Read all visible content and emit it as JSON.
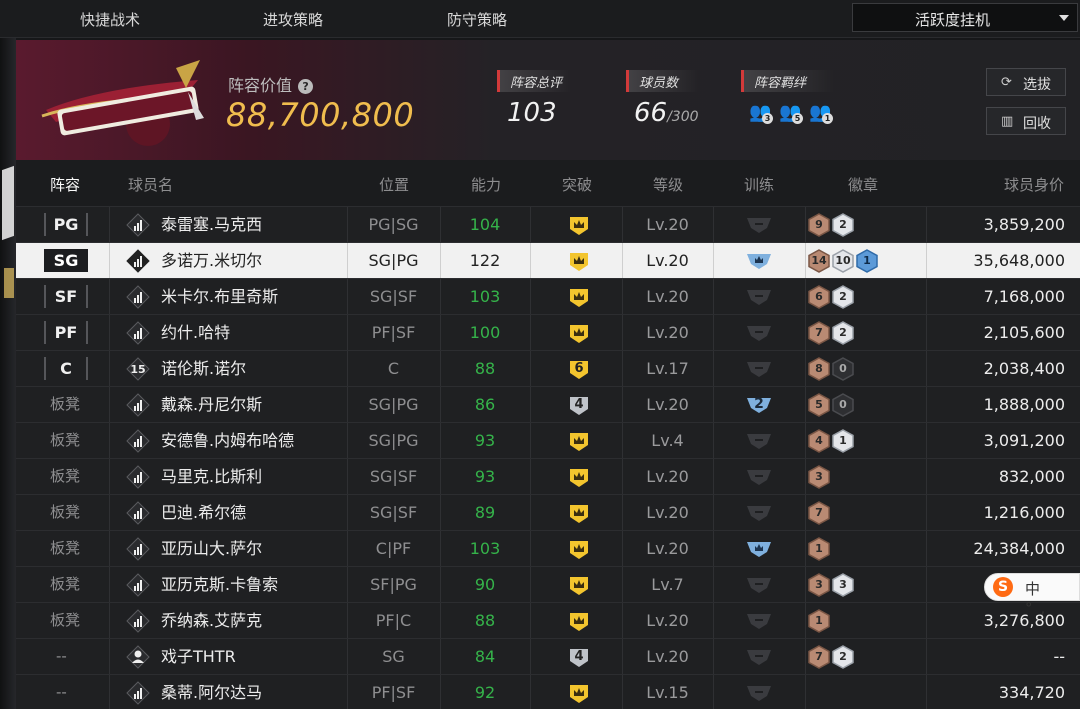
{
  "nav": {
    "tab1": "快捷战术",
    "tab2": "进攻策略",
    "tab3": "防守策略",
    "dropdown": "活跃度挂机"
  },
  "header": {
    "lineup_value_label": "阵容价值",
    "lineup_value": "88,700,800",
    "overall_label": "阵容总评",
    "overall_value": "103",
    "players_label": "球员数",
    "players_value": "66",
    "players_max": "/300",
    "bond_label": "阵容羁绊",
    "bonds": [
      "3",
      "5",
      "1"
    ],
    "draft_button": "选拔",
    "recycle_button": "回收"
  },
  "table": {
    "headers": [
      "阵容",
      "球员名",
      "位置",
      "能力",
      "突破",
      "等级",
      "训练",
      "徽章",
      "球员身价"
    ],
    "rows": [
      {
        "slot": "PG",
        "slot_type": "starter",
        "name": "泰雷塞.马克西",
        "icon": "bars",
        "pos": "PG|SG",
        "ability": "104",
        "ability_color": "#35b34a",
        "break": "crown",
        "level": "Lv.20",
        "train": "none",
        "badges": [
          [
            "9",
            "bronze"
          ],
          [
            "2",
            "silver"
          ]
        ],
        "value": "3,859,200",
        "selected": false
      },
      {
        "slot": "SG",
        "slot_type": "starter",
        "name": "多诺万.米切尔",
        "icon": "bars",
        "pos": "SG|PG",
        "ability": "122",
        "ability_color": "#222222",
        "break": "crown",
        "level": "Lv.20",
        "train": "crown",
        "badges": [
          [
            "14",
            "bronze"
          ],
          [
            "10",
            "silver"
          ],
          [
            "1",
            "blue"
          ]
        ],
        "value": "35,648,000",
        "selected": true
      },
      {
        "slot": "SF",
        "slot_type": "starter",
        "name": "米卡尔.布里奇斯",
        "icon": "bars",
        "pos": "SG|SF",
        "ability": "103",
        "ability_color": "#35b34a",
        "break": "crown",
        "level": "Lv.20",
        "train": "none",
        "badges": [
          [
            "6",
            "bronze"
          ],
          [
            "2",
            "silver"
          ]
        ],
        "value": "7,168,000",
        "selected": false
      },
      {
        "slot": "PF",
        "slot_type": "starter",
        "name": "约什.哈特",
        "icon": "bars",
        "pos": "PF|SF",
        "ability": "100",
        "ability_color": "#35b34a",
        "break": "crown",
        "level": "Lv.20",
        "train": "none",
        "badges": [
          [
            "7",
            "bronze"
          ],
          [
            "2",
            "silver"
          ]
        ],
        "value": "2,105,600",
        "selected": false
      },
      {
        "slot": "C",
        "slot_type": "starter",
        "name": "诺伦斯.诺尔",
        "icon": "15",
        "pos": "C",
        "ability": "88",
        "ability_color": "#35b34a",
        "break": "6",
        "level": "Lv.17",
        "train": "none",
        "badges": [
          [
            "8",
            "bronze"
          ],
          [
            "0",
            "dark"
          ]
        ],
        "value": "2,038,400",
        "selected": false
      },
      {
        "slot": "板凳",
        "slot_type": "bench",
        "name": "戴森.丹尼尔斯",
        "icon": "bars",
        "pos": "SG|PG",
        "ability": "86",
        "ability_color": "#35b34a",
        "break": "4",
        "level": "Lv.20",
        "train": "2",
        "badges": [
          [
            "5",
            "bronze"
          ],
          [
            "0",
            "dark"
          ]
        ],
        "value": "1,888,000",
        "selected": false
      },
      {
        "slot": "板凳",
        "slot_type": "bench",
        "name": "安德鲁.内姆布哈德",
        "icon": "bars",
        "pos": "SG|PG",
        "ability": "93",
        "ability_color": "#35b34a",
        "break": "crown",
        "level": "Lv.4",
        "train": "none",
        "badges": [
          [
            "4",
            "bronze"
          ],
          [
            "1",
            "silver"
          ]
        ],
        "value": "3,091,200",
        "selected": false
      },
      {
        "slot": "板凳",
        "slot_type": "bench",
        "name": "马里克.比斯利",
        "icon": "bars",
        "pos": "SG|SF",
        "ability": "93",
        "ability_color": "#35b34a",
        "break": "crown",
        "level": "Lv.20",
        "train": "none",
        "badges": [
          [
            "3",
            "bronze"
          ]
        ],
        "value": "832,000",
        "selected": false
      },
      {
        "slot": "板凳",
        "slot_type": "bench",
        "name": "巴迪.希尔德",
        "icon": "bars",
        "pos": "SG|SF",
        "ability": "89",
        "ability_color": "#35b34a",
        "break": "crown",
        "level": "Lv.20",
        "train": "none",
        "badges": [
          [
            "7",
            "bronze"
          ]
        ],
        "value": "1,216,000",
        "selected": false
      },
      {
        "slot": "板凳",
        "slot_type": "bench",
        "name": "亚历山大.萨尔",
        "icon": "bars",
        "pos": "C|PF",
        "ability": "103",
        "ability_color": "#35b34a",
        "break": "crown",
        "level": "Lv.20",
        "train": "crown",
        "badges": [
          [
            "1",
            "bronze"
          ]
        ],
        "value": "24,384,000",
        "selected": false
      },
      {
        "slot": "板凳",
        "slot_type": "bench",
        "name": "亚历克斯.卡鲁索",
        "icon": "bars",
        "pos": "SF|PG",
        "ability": "90",
        "ability_color": "#35b34a",
        "break": "crown",
        "level": "Lv.7",
        "train": "none",
        "badges": [
          [
            "3",
            "bronze"
          ],
          [
            "3",
            "silver"
          ]
        ],
        "value": "",
        "selected": false
      },
      {
        "slot": "板凳",
        "slot_type": "bench",
        "name": "乔纳森.艾萨克",
        "icon": "bars",
        "pos": "PF|C",
        "ability": "88",
        "ability_color": "#35b34a",
        "break": "crown",
        "level": "Lv.20",
        "train": "none",
        "badges": [
          [
            "1",
            "bronze"
          ]
        ],
        "value": "3,276,800",
        "selected": false
      },
      {
        "slot": "--",
        "slot_type": "none",
        "name": "戏子THTR",
        "icon": "person",
        "pos": "SG",
        "ability": "84",
        "ability_color": "#35b34a",
        "break": "4",
        "level": "Lv.20",
        "train": "none",
        "badges": [
          [
            "7",
            "bronze"
          ],
          [
            "2",
            "silver"
          ]
        ],
        "value": "--",
        "selected": false
      },
      {
        "slot": "--",
        "slot_type": "none",
        "name": "桑蒂.阿尔达马",
        "icon": "bars",
        "pos": "PF|SF",
        "ability": "92",
        "ability_color": "#35b34a",
        "break": "crown",
        "level": "Lv.15",
        "train": "none",
        "badges": [],
        "value": "334,720",
        "selected": false
      }
    ]
  },
  "ime": {
    "letter": "S",
    "text": "中 °,"
  }
}
